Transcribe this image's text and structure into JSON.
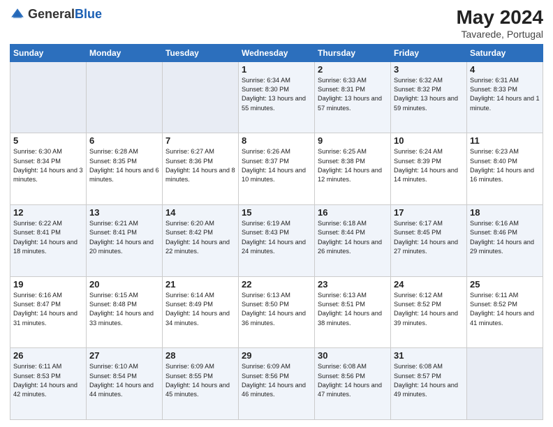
{
  "header": {
    "logo_general": "General",
    "logo_blue": "Blue",
    "month_year": "May 2024",
    "location": "Tavarede, Portugal"
  },
  "weekdays": [
    "Sunday",
    "Monday",
    "Tuesday",
    "Wednesday",
    "Thursday",
    "Friday",
    "Saturday"
  ],
  "weeks": [
    [
      {
        "day": "",
        "sunrise": "",
        "sunset": "",
        "daylight": "",
        "empty": true
      },
      {
        "day": "",
        "sunrise": "",
        "sunset": "",
        "daylight": "",
        "empty": true
      },
      {
        "day": "",
        "sunrise": "",
        "sunset": "",
        "daylight": "",
        "empty": true
      },
      {
        "day": "1",
        "sunrise": "Sunrise: 6:34 AM",
        "sunset": "Sunset: 8:30 PM",
        "daylight": "Daylight: 13 hours and 55 minutes."
      },
      {
        "day": "2",
        "sunrise": "Sunrise: 6:33 AM",
        "sunset": "Sunset: 8:31 PM",
        "daylight": "Daylight: 13 hours and 57 minutes."
      },
      {
        "day": "3",
        "sunrise": "Sunrise: 6:32 AM",
        "sunset": "Sunset: 8:32 PM",
        "daylight": "Daylight: 13 hours and 59 minutes."
      },
      {
        "day": "4",
        "sunrise": "Sunrise: 6:31 AM",
        "sunset": "Sunset: 8:33 PM",
        "daylight": "Daylight: 14 hours and 1 minute."
      }
    ],
    [
      {
        "day": "5",
        "sunrise": "Sunrise: 6:30 AM",
        "sunset": "Sunset: 8:34 PM",
        "daylight": "Daylight: 14 hours and 3 minutes."
      },
      {
        "day": "6",
        "sunrise": "Sunrise: 6:28 AM",
        "sunset": "Sunset: 8:35 PM",
        "daylight": "Daylight: 14 hours and 6 minutes."
      },
      {
        "day": "7",
        "sunrise": "Sunrise: 6:27 AM",
        "sunset": "Sunset: 8:36 PM",
        "daylight": "Daylight: 14 hours and 8 minutes."
      },
      {
        "day": "8",
        "sunrise": "Sunrise: 6:26 AM",
        "sunset": "Sunset: 8:37 PM",
        "daylight": "Daylight: 14 hours and 10 minutes."
      },
      {
        "day": "9",
        "sunrise": "Sunrise: 6:25 AM",
        "sunset": "Sunset: 8:38 PM",
        "daylight": "Daylight: 14 hours and 12 minutes."
      },
      {
        "day": "10",
        "sunrise": "Sunrise: 6:24 AM",
        "sunset": "Sunset: 8:39 PM",
        "daylight": "Daylight: 14 hours and 14 minutes."
      },
      {
        "day": "11",
        "sunrise": "Sunrise: 6:23 AM",
        "sunset": "Sunset: 8:40 PM",
        "daylight": "Daylight: 14 hours and 16 minutes."
      }
    ],
    [
      {
        "day": "12",
        "sunrise": "Sunrise: 6:22 AM",
        "sunset": "Sunset: 8:41 PM",
        "daylight": "Daylight: 14 hours and 18 minutes."
      },
      {
        "day": "13",
        "sunrise": "Sunrise: 6:21 AM",
        "sunset": "Sunset: 8:41 PM",
        "daylight": "Daylight: 14 hours and 20 minutes."
      },
      {
        "day": "14",
        "sunrise": "Sunrise: 6:20 AM",
        "sunset": "Sunset: 8:42 PM",
        "daylight": "Daylight: 14 hours and 22 minutes."
      },
      {
        "day": "15",
        "sunrise": "Sunrise: 6:19 AM",
        "sunset": "Sunset: 8:43 PM",
        "daylight": "Daylight: 14 hours and 24 minutes."
      },
      {
        "day": "16",
        "sunrise": "Sunrise: 6:18 AM",
        "sunset": "Sunset: 8:44 PM",
        "daylight": "Daylight: 14 hours and 26 minutes."
      },
      {
        "day": "17",
        "sunrise": "Sunrise: 6:17 AM",
        "sunset": "Sunset: 8:45 PM",
        "daylight": "Daylight: 14 hours and 27 minutes."
      },
      {
        "day": "18",
        "sunrise": "Sunrise: 6:16 AM",
        "sunset": "Sunset: 8:46 PM",
        "daylight": "Daylight: 14 hours and 29 minutes."
      }
    ],
    [
      {
        "day": "19",
        "sunrise": "Sunrise: 6:16 AM",
        "sunset": "Sunset: 8:47 PM",
        "daylight": "Daylight: 14 hours and 31 minutes."
      },
      {
        "day": "20",
        "sunrise": "Sunrise: 6:15 AM",
        "sunset": "Sunset: 8:48 PM",
        "daylight": "Daylight: 14 hours and 33 minutes."
      },
      {
        "day": "21",
        "sunrise": "Sunrise: 6:14 AM",
        "sunset": "Sunset: 8:49 PM",
        "daylight": "Daylight: 14 hours and 34 minutes."
      },
      {
        "day": "22",
        "sunrise": "Sunrise: 6:13 AM",
        "sunset": "Sunset: 8:50 PM",
        "daylight": "Daylight: 14 hours and 36 minutes."
      },
      {
        "day": "23",
        "sunrise": "Sunrise: 6:13 AM",
        "sunset": "Sunset: 8:51 PM",
        "daylight": "Daylight: 14 hours and 38 minutes."
      },
      {
        "day": "24",
        "sunrise": "Sunrise: 6:12 AM",
        "sunset": "Sunset: 8:52 PM",
        "daylight": "Daylight: 14 hours and 39 minutes."
      },
      {
        "day": "25",
        "sunrise": "Sunrise: 6:11 AM",
        "sunset": "Sunset: 8:52 PM",
        "daylight": "Daylight: 14 hours and 41 minutes."
      }
    ],
    [
      {
        "day": "26",
        "sunrise": "Sunrise: 6:11 AM",
        "sunset": "Sunset: 8:53 PM",
        "daylight": "Daylight: 14 hours and 42 minutes."
      },
      {
        "day": "27",
        "sunrise": "Sunrise: 6:10 AM",
        "sunset": "Sunset: 8:54 PM",
        "daylight": "Daylight: 14 hours and 44 minutes."
      },
      {
        "day": "28",
        "sunrise": "Sunrise: 6:09 AM",
        "sunset": "Sunset: 8:55 PM",
        "daylight": "Daylight: 14 hours and 45 minutes."
      },
      {
        "day": "29",
        "sunrise": "Sunrise: 6:09 AM",
        "sunset": "Sunset: 8:56 PM",
        "daylight": "Daylight: 14 hours and 46 minutes."
      },
      {
        "day": "30",
        "sunrise": "Sunrise: 6:08 AM",
        "sunset": "Sunset: 8:56 PM",
        "daylight": "Daylight: 14 hours and 47 minutes."
      },
      {
        "day": "31",
        "sunrise": "Sunrise: 6:08 AM",
        "sunset": "Sunset: 8:57 PM",
        "daylight": "Daylight: 14 hours and 49 minutes."
      },
      {
        "day": "",
        "sunrise": "",
        "sunset": "",
        "daylight": "",
        "empty": true
      }
    ]
  ]
}
